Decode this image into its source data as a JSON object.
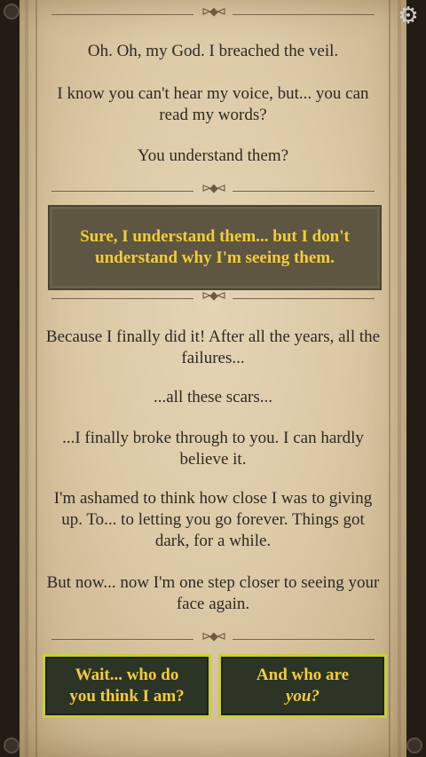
{
  "settings_icon": "gear-icon",
  "story": {
    "p1": "Oh. Oh, my God. I breached the veil.",
    "p2": "I know you can't hear my voice, but... you can read my words?",
    "p3": "You understand them?",
    "player_choice": "Sure, I understand them... but I don't understand why I'm seeing them.",
    "p4": "Because I finally did it! After all the years, all the failures...",
    "p5": "...all these scars...",
    "p6": "...I finally broke through to you. I can hardly believe it.",
    "p7": "I'm ashamed to think how close I was to giving up. To... to letting you go forever. Things got dark, for a while.",
    "p8": "But now... now I'm one step closer to seeing your face again."
  },
  "choices": {
    "option1": "Wait... who do you think I am?",
    "option2_prefix": "And who are",
    "option2_emph": "you?"
  },
  "colors": {
    "choice_text": "#f2cc3a",
    "button_border": "#c9cf36",
    "button_bg": "#2c3426",
    "panel_bg": "#5e5640"
  }
}
